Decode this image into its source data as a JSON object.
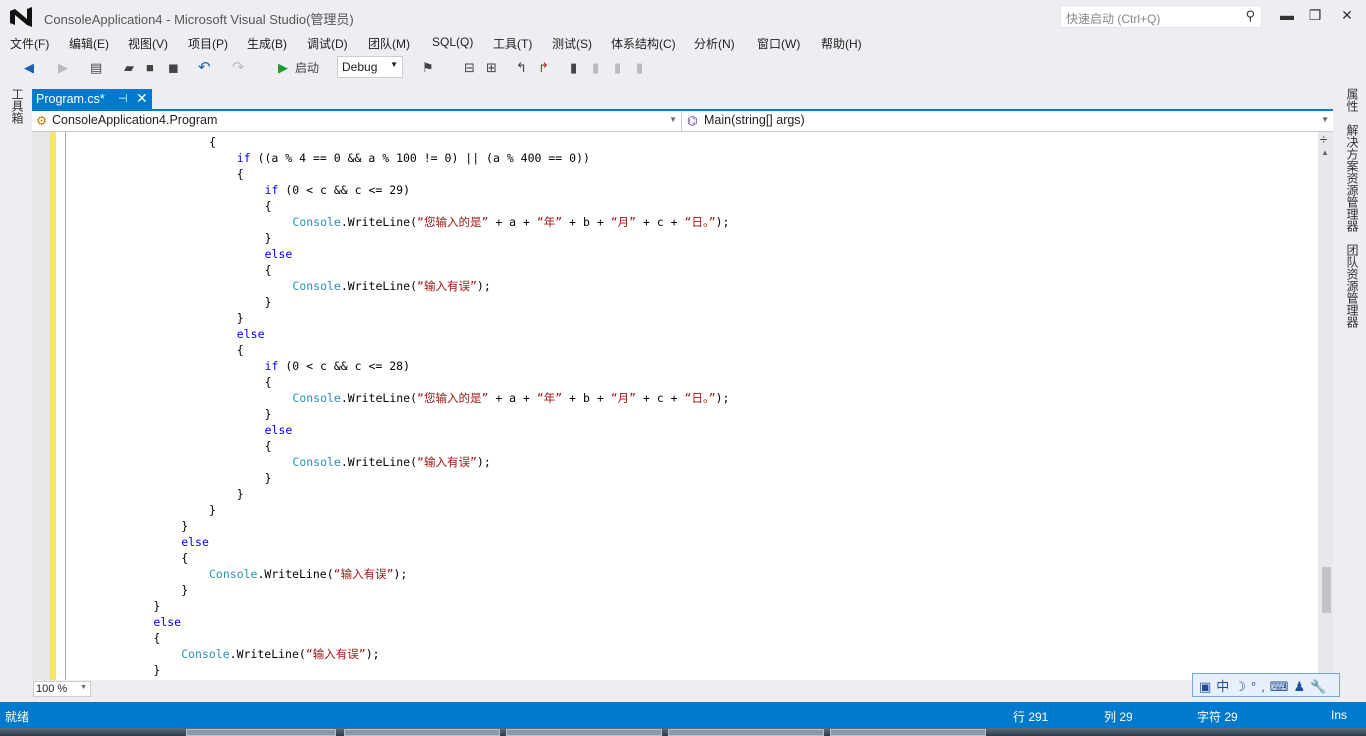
{
  "window": {
    "title": "ConsoleApplication4 - Microsoft Visual Studio(管理员)",
    "quick_launch_placeholder": "快速启动 (Ctrl+Q)",
    "minimize": "▬",
    "restore": "❐",
    "close": "✕"
  },
  "menu": [
    "文件(F)",
    "编辑(E)",
    "视图(V)",
    "项目(P)",
    "生成(B)",
    "调试(D)",
    "团队(M)",
    "SQL(Q)",
    "工具(T)",
    "测试(S)",
    "体系结构(C)",
    "分析(N)",
    "窗口(W)",
    "帮助(H)"
  ],
  "toolbar": {
    "start_label": "启动",
    "config": "Debug"
  },
  "left_panel": {
    "toolbox": "工具箱"
  },
  "right_panel": [
    "属性",
    "解决方案资源管理器",
    "团队资源管理器"
  ],
  "tab": {
    "label": "Program.cs*",
    "pin": "⊣",
    "close": "✕"
  },
  "navbar": {
    "class": "ConsoleApplication4.Program",
    "member": "Main(string[] args)"
  },
  "code": [
    {
      "indent": 20,
      "tokens": [
        [
          "pl",
          "{"
        ]
      ]
    },
    {
      "indent": 24,
      "tokens": [
        [
          "kw",
          "if"
        ],
        [
          "pl",
          " ((a % 4 == 0 && a % 100 != 0) || (a % 400 == 0))"
        ]
      ]
    },
    {
      "indent": 24,
      "tokens": [
        [
          "pl",
          "{"
        ]
      ]
    },
    {
      "indent": 28,
      "tokens": [
        [
          "kw",
          "if"
        ],
        [
          "pl",
          " (0 < c && c <= 29)"
        ]
      ]
    },
    {
      "indent": 28,
      "tokens": [
        [
          "pl",
          "{"
        ]
      ]
    },
    {
      "indent": 32,
      "tokens": [
        [
          "ty",
          "Console"
        ],
        [
          "pl",
          ".WriteLine("
        ],
        [
          "st",
          "“您输入的是”"
        ],
        [
          "pl",
          " + a + "
        ],
        [
          "st",
          "“年”"
        ],
        [
          "pl",
          " + b + "
        ],
        [
          "st",
          "“月”"
        ],
        [
          "pl",
          " + c + "
        ],
        [
          "st",
          "“日。”"
        ],
        [
          "pl",
          ");"
        ]
      ]
    },
    {
      "indent": 28,
      "tokens": [
        [
          "pl",
          "}"
        ]
      ]
    },
    {
      "indent": 28,
      "tokens": [
        [
          "kw",
          "else"
        ]
      ]
    },
    {
      "indent": 28,
      "tokens": [
        [
          "pl",
          "{"
        ]
      ]
    },
    {
      "indent": 32,
      "tokens": [
        [
          "ty",
          "Console"
        ],
        [
          "pl",
          ".WriteLine("
        ],
        [
          "st",
          "“输入有误”"
        ],
        [
          "pl",
          ");"
        ]
      ]
    },
    {
      "indent": 28,
      "tokens": [
        [
          "pl",
          "}"
        ]
      ]
    },
    {
      "indent": 24,
      "tokens": [
        [
          "pl",
          "}"
        ]
      ]
    },
    {
      "indent": 24,
      "tokens": [
        [
          "kw",
          "else"
        ]
      ]
    },
    {
      "indent": 24,
      "tokens": [
        [
          "pl",
          "{"
        ]
      ]
    },
    {
      "indent": 28,
      "tokens": [
        [
          "kw",
          "if"
        ],
        [
          "pl",
          " (0 < c && c <= 28)"
        ]
      ]
    },
    {
      "indent": 28,
      "tokens": [
        [
          "pl",
          "{"
        ]
      ]
    },
    {
      "indent": 32,
      "tokens": [
        [
          "ty",
          "Console"
        ],
        [
          "pl",
          ".WriteLine("
        ],
        [
          "st",
          "“您输入的是”"
        ],
        [
          "pl",
          " + a + "
        ],
        [
          "st",
          "“年”"
        ],
        [
          "pl",
          " + b + "
        ],
        [
          "st",
          "“月”"
        ],
        [
          "pl",
          " + c + "
        ],
        [
          "st",
          "“日。”"
        ],
        [
          "pl",
          ");"
        ]
      ]
    },
    {
      "indent": 28,
      "tokens": [
        [
          "pl",
          "}"
        ]
      ]
    },
    {
      "indent": 28,
      "tokens": [
        [
          "kw",
          "else"
        ]
      ]
    },
    {
      "indent": 28,
      "tokens": [
        [
          "pl",
          "{"
        ]
      ]
    },
    {
      "indent": 32,
      "tokens": [
        [
          "ty",
          "Console"
        ],
        [
          "pl",
          ".WriteLine("
        ],
        [
          "st",
          "“输入有误”"
        ],
        [
          "pl",
          ");"
        ]
      ]
    },
    {
      "indent": 28,
      "tokens": [
        [
          "pl",
          "}"
        ]
      ]
    },
    {
      "indent": 24,
      "tokens": [
        [
          "pl",
          "}"
        ]
      ]
    },
    {
      "indent": 20,
      "tokens": [
        [
          "pl",
          "}"
        ]
      ]
    },
    {
      "indent": 16,
      "tokens": [
        [
          "pl",
          "}"
        ]
      ]
    },
    {
      "indent": 16,
      "tokens": [
        [
          "kw",
          "else"
        ]
      ]
    },
    {
      "indent": 16,
      "tokens": [
        [
          "pl",
          "{"
        ]
      ]
    },
    {
      "indent": 20,
      "tokens": [
        [
          "ty",
          "Console"
        ],
        [
          "pl",
          ".WriteLine("
        ],
        [
          "st",
          "“输入有误”"
        ],
        [
          "pl",
          ");"
        ]
      ]
    },
    {
      "indent": 16,
      "tokens": [
        [
          "pl",
          "}"
        ]
      ]
    },
    {
      "indent": 12,
      "tokens": [
        [
          "pl",
          "}"
        ]
      ]
    },
    {
      "indent": 12,
      "tokens": [
        [
          "kw",
          "else"
        ]
      ]
    },
    {
      "indent": 12,
      "tokens": [
        [
          "pl",
          "{"
        ]
      ]
    },
    {
      "indent": 16,
      "tokens": [
        [
          "ty",
          "Console"
        ],
        [
          "pl",
          ".WriteLine("
        ],
        [
          "st",
          "“输入有误”"
        ],
        [
          "pl",
          ");"
        ]
      ]
    },
    {
      "indent": 12,
      "tokens": [
        [
          "pl",
          "}"
        ]
      ]
    },
    {
      "indent": 8,
      "tokens": [
        [
          "pl",
          "}"
        ]
      ]
    }
  ],
  "zoom": "100 %",
  "ime": "中",
  "status": {
    "ready": "就绪",
    "line": "行 291",
    "col": "列 29",
    "char": "字符 29",
    "mode": "Ins"
  },
  "colors": {
    "accent": "#007acc",
    "keyword": "#0000ff",
    "type": "#2b91af",
    "string": "#a31515"
  }
}
